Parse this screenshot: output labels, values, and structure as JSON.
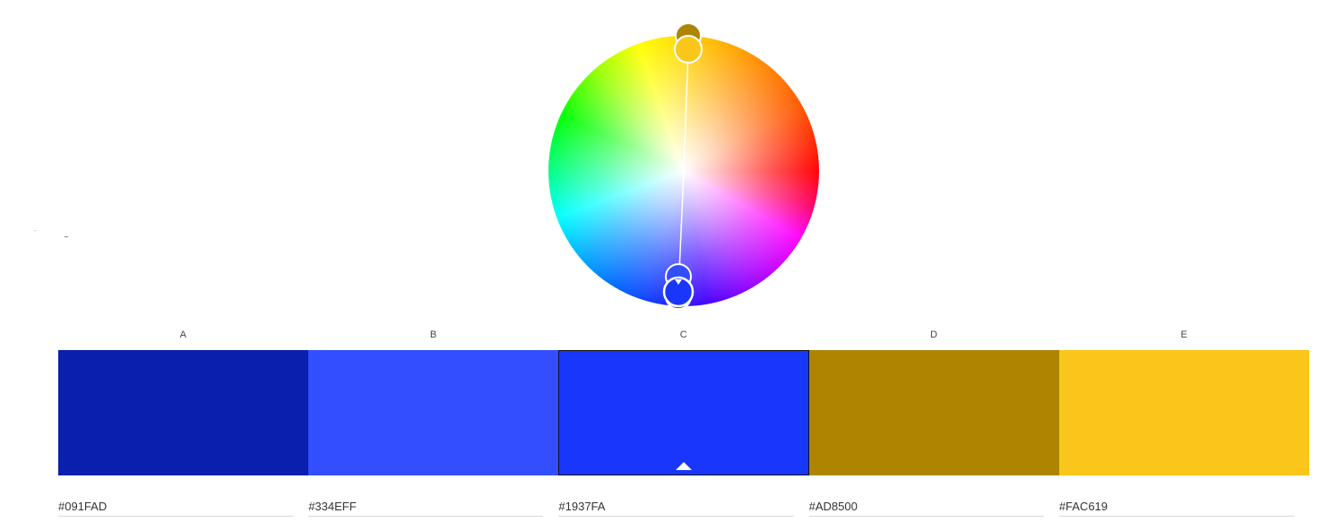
{
  "color_wheel": {
    "handles": [
      {
        "name": "handle-d",
        "color": "#AD8500"
      },
      {
        "name": "handle-e",
        "color": "#FAC619"
      },
      {
        "name": "handle-b",
        "color": "#334EFF"
      },
      {
        "name": "handle-a",
        "color": "#091FAD"
      },
      {
        "name": "handle-c",
        "color": "#1937FA"
      }
    ]
  },
  "swatches": [
    {
      "label": "A",
      "hex": "#091FAD",
      "color": "#091FAD",
      "selected": false
    },
    {
      "label": "B",
      "hex": "#334EFF",
      "color": "#334EFF",
      "selected": false
    },
    {
      "label": "C",
      "hex": "#1937FA",
      "color": "#1937FA",
      "selected": true
    },
    {
      "label": "D",
      "hex": "#AD8500",
      "color": "#AD8500",
      "selected": false
    },
    {
      "label": "E",
      "hex": "#FAC619",
      "color": "#FAC619",
      "selected": false
    }
  ],
  "icons": {
    "selected_indicator": "caret-up-icon"
  }
}
